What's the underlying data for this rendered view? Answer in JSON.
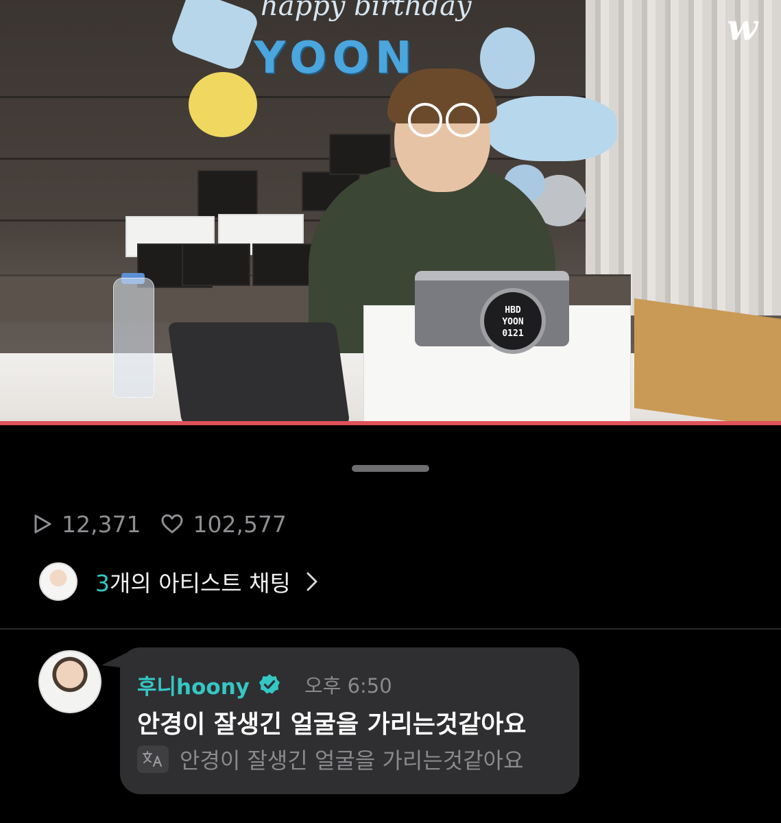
{
  "app": {
    "logo": "w"
  },
  "video": {
    "banner_top": "happy birthday",
    "banner_name": "YOON",
    "lens_lines": [
      "HBD",
      "YOON",
      "0121"
    ]
  },
  "stats": {
    "plays_icon": "play-icon",
    "plays": "12,371",
    "likes_icon": "heart-icon",
    "likes": "102,577"
  },
  "artist_chat": {
    "count": "3",
    "label": "개의 아티스트 채팅"
  },
  "comment": {
    "author": "후니hoony",
    "time": "오후 6:50",
    "text": "안경이 잘생긴 얼굴을 가리는것같아요",
    "translate_icon": "translate-icon",
    "translation": "안경이 잘생긴 얼굴을 가리는것같아요"
  },
  "colors": {
    "accent": "#35c7c4",
    "progress": "#e0525a",
    "bubble": "#2f2f31"
  }
}
